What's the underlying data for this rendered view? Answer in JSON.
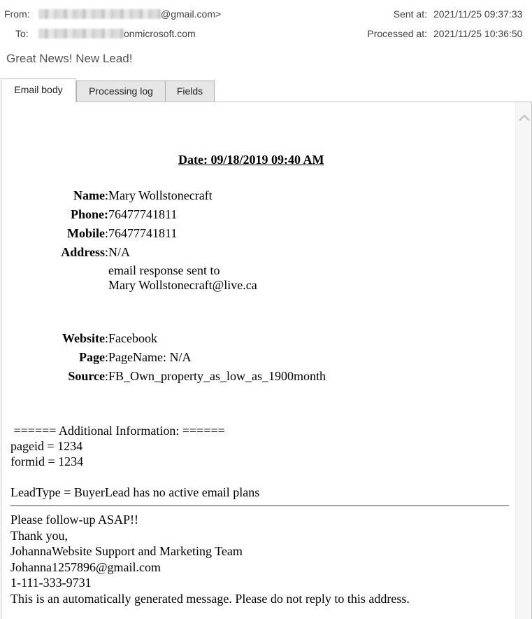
{
  "header": {
    "from_label": "From:",
    "from_value_visible": "@gmail.com>",
    "to_label": "To:",
    "to_value_visible": "onmicrosoft.com",
    "sent_label": "Sent at:",
    "sent_value": "2021/11/25 09:37:33",
    "processed_label": "Processed at:",
    "processed_value": "2021/11/25 10:36:50"
  },
  "subject": "Great News! New Lead!",
  "tabs": [
    {
      "label": "Email body",
      "active": true
    },
    {
      "label": "Processing log",
      "active": false
    },
    {
      "label": "Fields",
      "active": false
    }
  ],
  "email": {
    "date_line": "Date: 09/18/2019 09:40 AM",
    "fields": [
      {
        "label": "Name",
        "value": "Mary Wollstonecraft"
      },
      {
        "label": "Phone:",
        "value": "76477741811"
      },
      {
        "label": "Mobile",
        "value": "76477741811"
      },
      {
        "label": "Address",
        "value": "N/A"
      },
      {
        "label": "",
        "value": "email response sent to"
      },
      {
        "label": "",
        "value": "Mary Wollstonecraft@live.ca"
      },
      {
        "label": "Website",
        "value": "Facebook"
      },
      {
        "label": "Page",
        "value": "PageName: N/A"
      },
      {
        "label": "Source",
        "value": "FB_Own_property_as_low_as_1900month"
      }
    ],
    "additional_info": [
      " ====== Additional Information: ======",
      "pageid = 1234",
      "formid = 1234",
      "",
      "LeadType = BuyerLead has no active email plans"
    ],
    "footer": [
      "Please follow-up ASAP!!",
      "Thank you,",
      "JohannaWebsite Support and Marketing Team",
      "Johanna1257896@gmail.com",
      "1-111-333-9731",
      "This is an automatically generated message. Please do not reply to this address."
    ]
  },
  "icons": {
    "scroll_up": "chevron-up-icon"
  }
}
